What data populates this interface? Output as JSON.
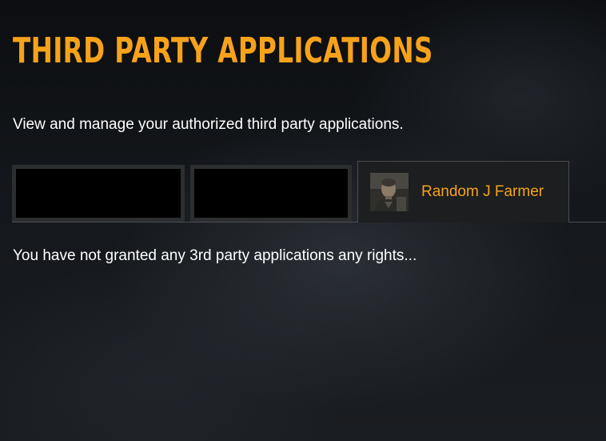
{
  "page": {
    "title": "THIRD PARTY APPLICATIONS",
    "intro": "View and manage your authorized third party applications."
  },
  "tabs": [
    {
      "label": ""
    },
    {
      "label": ""
    },
    {
      "label": "Random J Farmer",
      "icon": "character-portrait-icon",
      "selected": true
    }
  ],
  "status_message": "You have not granted any 3rd party applications any rights...",
  "colors": {
    "accent": "#f7a21b",
    "text": "#ffffff",
    "background": "#14171b",
    "tab_border": "#2c2e30"
  }
}
